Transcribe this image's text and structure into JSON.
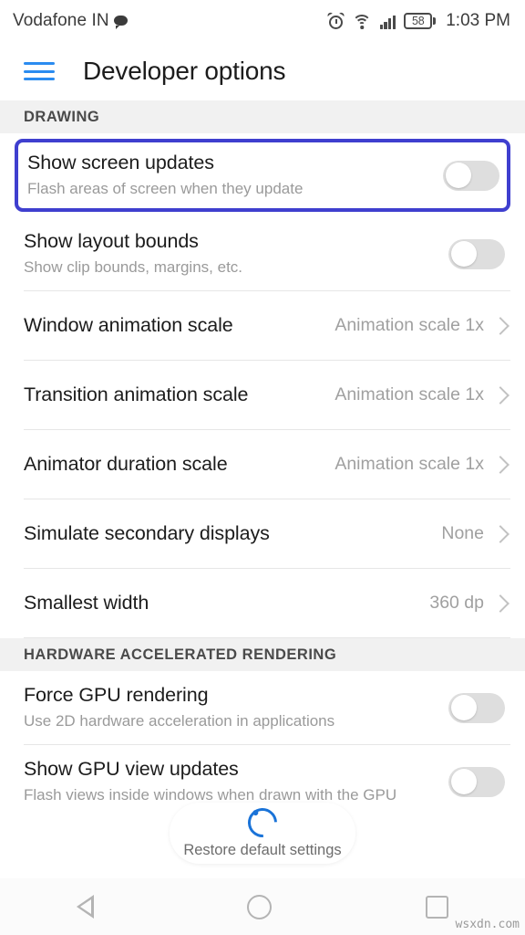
{
  "status_bar": {
    "carrier": "Vodafone IN",
    "chat_icon": "chat-bubble-icon",
    "alarm_icon": "alarm-clock-icon",
    "wifi_icon": "wifi-icon",
    "signal_icon": "cellular-signal-icon",
    "battery_level": "58",
    "time": "1:03 PM"
  },
  "app_bar": {
    "menu_icon": "hamburger-menu-icon",
    "title": "Developer options",
    "menu_color": "#2b8cf0"
  },
  "sections": [
    {
      "header": "DRAWING",
      "rows": [
        {
          "title": "Show screen updates",
          "subtitle": "Flash areas of screen when they update",
          "control": "toggle",
          "toggle_state": "off",
          "highlighted": true
        },
        {
          "title": "Show layout bounds",
          "subtitle": "Show clip bounds, margins, etc.",
          "control": "toggle",
          "toggle_state": "off",
          "highlighted": false
        },
        {
          "title": "Window animation scale",
          "subtitle": "",
          "control": "value",
          "value": "Animation scale 1x",
          "highlighted": false
        },
        {
          "title": "Transition animation scale",
          "subtitle": "",
          "control": "value",
          "value": "Animation scale 1x",
          "highlighted": false
        },
        {
          "title": "Animator duration scale",
          "subtitle": "",
          "control": "value",
          "value": "Animation scale 1x",
          "highlighted": false
        },
        {
          "title": "Simulate secondary displays",
          "subtitle": "",
          "control": "value",
          "value": "None",
          "highlighted": false
        },
        {
          "title": "Smallest width",
          "subtitle": "",
          "control": "value",
          "value": "360 dp",
          "highlighted": false
        }
      ]
    },
    {
      "header": "HARDWARE ACCELERATED RENDERING",
      "rows": [
        {
          "title": "Force GPU rendering",
          "subtitle": "Use 2D hardware acceleration in applications",
          "control": "toggle",
          "toggle_state": "off",
          "highlighted": false
        },
        {
          "title": "Show GPU view updates",
          "subtitle": "Flash views inside windows when drawn with the GPU",
          "control": "toggle",
          "toggle_state": "off",
          "highlighted": false
        }
      ]
    }
  ],
  "toast": {
    "label": "Restore default settings",
    "spinner_icon": "loading-spinner-icon",
    "spinner_color": "#1a73d8"
  },
  "nav_bar": {
    "back_label": "back-icon",
    "home_label": "home-icon",
    "recents_label": "recents-icon"
  },
  "watermark": "wsxdn.com",
  "colors": {
    "highlight_border": "#3f3fcf",
    "section_header_bg": "#f1f1f1",
    "toggle_track_off": "#dedede"
  }
}
